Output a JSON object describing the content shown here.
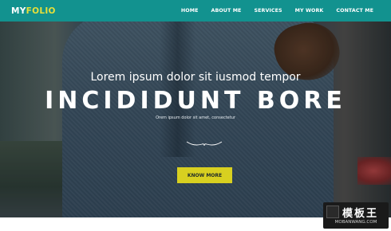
{
  "brand": {
    "logo_part1": "MY",
    "logo_part2": "FOLIO"
  },
  "nav": {
    "items": [
      "HOME",
      "ABOUT ME",
      "SERVICES",
      "MY WORK",
      "CONTACT ME"
    ]
  },
  "hero": {
    "subtitle": "Lorem ipsum dolor sit iusmod tempor",
    "headline": "INCIDIDUNT BORE",
    "tagline": "Orem ipsum dolor sit amet, consectetur",
    "cta_label": "KNOW MORE"
  },
  "watermark": {
    "title": "模板王",
    "url": "MOBANWANG.COM"
  },
  "colors": {
    "navbar": "#12928f",
    "accent": "#e7df3a",
    "cta": "#d8d020"
  }
}
